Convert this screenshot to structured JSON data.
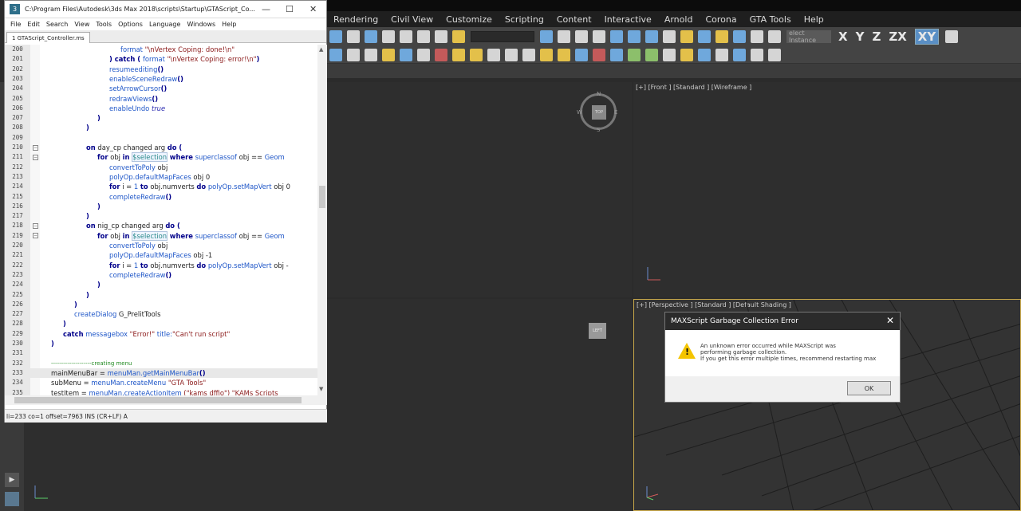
{
  "max": {
    "menus": [
      "Rendering",
      "Civil View",
      "Customize",
      "Scripting",
      "Content",
      "Interactive",
      "Arnold",
      "Corona",
      "GTA Tools",
      "Help"
    ],
    "named_selection": "elect Instance",
    "axes": [
      "X",
      "Y",
      "Z",
      "ZX",
      "XY"
    ],
    "viewports": {
      "front_label": "[+] [Front ] [Standard ] [Wireframe ]",
      "persp_label": "[+] [Perspective ] [Standard ] [Default Shading ]",
      "viewcube_top": "TOP",
      "viewcube_left": "LEFT",
      "compass": {
        "n": "N",
        "w": "W",
        "e": "E",
        "s": "S"
      }
    },
    "left_strip_btn": "▶"
  },
  "dialog": {
    "title": "MAXScript Garbage Collection Error",
    "message_line1": "An unknown error occurred while MAXScript was",
    "message_line2": "performing garbage collection.",
    "message_line3": "If you get this error multiple times, recommend restarting max",
    "ok_label": "OK",
    "close": "✕"
  },
  "editor": {
    "title": "C:\\Program Files\\Autodesk\\3ds Max 2018\\scripts\\Startup\\GTAScript_Co...",
    "app_icon": "3",
    "menus": [
      "File",
      "Edit",
      "Search",
      "View",
      "Tools",
      "Options",
      "Language",
      "Windows",
      "Help"
    ],
    "tab": "1 GTAScript_Controller.ms",
    "status": "li=233 co=1 offset=7963 INS (CR+LF) A",
    "line_numbers": [
      "200",
      "201",
      "202",
      "203",
      "204",
      "205",
      "206",
      "207",
      "208",
      "209",
      "210",
      "211",
      "212",
      "213",
      "214",
      "215",
      "216",
      "217",
      "218",
      "219",
      "220",
      "221",
      "222",
      "223",
      "224",
      "225",
      "226",
      "227",
      "228",
      "229",
      "230",
      "231",
      "232",
      "233",
      "234",
      "235"
    ],
    "tokens": {
      "l200_a": "format ",
      "l200_b": "\"\\nVertex Coping: done!\\n\"",
      "l201_a": ") ",
      "l201_b": "catch",
      "l201_c": " ( ",
      "l201_d": "format",
      "l201_e": " \"\\nVertex Coping: error!\\n\"",
      "l201_f": ")",
      "l202": "resumeediting",
      "l202_p": "()",
      "l203": "enableSceneRedraw",
      "l203_p": "()",
      "l204": "setArrowCursor",
      "l204_p": "()",
      "l205": "redrawViews",
      "l205_p": "()",
      "l206_a": "enableUndo ",
      "l206_b": "true",
      "l207": ")",
      "l208": ")",
      "l210_a": "on",
      "l210_b": " day_cp changed arg ",
      "l210_c": "do",
      "l210_d": " (",
      "l211_a": "for",
      "l211_b": " obj ",
      "l211_c": "in",
      "l211_d": " ",
      "l211_e": "$selection",
      "l211_f": " ",
      "l211_g": "where",
      "l211_h": " ",
      "l211_i": "superclassof",
      "l211_j": " obj == ",
      "l211_k": "Geom",
      "l212_a": "convertToPoly",
      "l212_b": " obj",
      "l213_a": "polyOp.defaultMapFaces",
      "l213_b": " obj 0",
      "l214_a": "for",
      "l214_b": " i = ",
      "l214_c": "1",
      "l214_d": " ",
      "l214_e": "to",
      "l214_f": " obj.numverts ",
      "l214_g": "do",
      "l214_h": " ",
      "l214_i": "polyOp.setMapVert",
      "l214_j": " obj 0",
      "l215": "completeRedraw",
      "l215_p": "()",
      "l216": ")",
      "l217": ")",
      "l218_a": "on",
      "l218_b": " nig_cp changed arg ",
      "l218_c": "do",
      "l218_d": " (",
      "l219_a": "for",
      "l219_b": " obj ",
      "l219_c": "in",
      "l219_d": " ",
      "l219_e": "$selection",
      "l219_f": "  ",
      "l219_g": "where",
      "l219_h": " ",
      "l219_i": "superclassof",
      "l219_j": " obj == ",
      "l219_k": "Geom",
      "l220_a": "convertToPoly",
      "l220_b": " obj",
      "l221_a": "polyOp.defaultMapFaces",
      "l221_b": " obj -1",
      "l222_a": "for",
      "l222_b": " i = ",
      "l222_c": "1",
      "l222_d": " ",
      "l222_e": "to",
      "l222_f": " obj.numverts ",
      "l222_g": "do",
      "l222_h": " ",
      "l222_i": "polyOp.setMapVert",
      "l222_j": " obj -",
      "l223": "completeRedraw",
      "l223_p": "()",
      "l224": ")",
      "l225": ")",
      "l226": ")",
      "l227_a": "createDialog",
      "l227_b": " G_PrelitTools",
      "l228": ")",
      "l229_a": "catch",
      "l229_b": " messagebox ",
      "l229_c": "\"Error!\"",
      "l229_d": " title:",
      "l229_e": "\"Can't run script\"",
      "l230": ")",
      "l232": "--------------------creating menu",
      "l233_a": "mainMenuBar = ",
      "l233_b": "menuMan.getMainMenuBar",
      "l233_c": "()",
      "l234_a": "subMenu = ",
      "l234_b": "menuMan.createMenu",
      "l234_c": " \"GTA Tools\"",
      "l235_a": "testItem = ",
      "l235_b": "menuMan.createActionItem",
      "l235_c": " (\"kams  dffio\") \"KAMs  Scripts"
    }
  }
}
